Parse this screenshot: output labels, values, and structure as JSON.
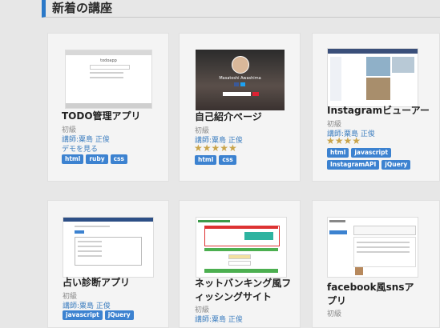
{
  "section": {
    "title": "新着の講座"
  },
  "cards": [
    {
      "title": "TODO管理アプリ",
      "level": "初級",
      "teacher": "講師:粟島 正俊",
      "demo": "デモを見る",
      "tags": [
        "html",
        "ruby",
        "css"
      ],
      "thumb": {
        "app_title": "todoapp"
      }
    },
    {
      "title": "自己紹介ページ",
      "level": "初級",
      "teacher": "講師:粟島 正俊",
      "stars": "★★★★★",
      "tags": [
        "html",
        "css"
      ],
      "thumb": {
        "name": "Masatoshi Awashima"
      }
    },
    {
      "title": "Instagramビューアー",
      "level": "初級",
      "teacher": "講師:粟島 正俊",
      "stars": "★★★★",
      "tags": [
        "html",
        "javascript",
        "InstagramAPI",
        "jQuery"
      ]
    },
    {
      "title": "占い診断アプリ",
      "level": "初級",
      "teacher": "講師:粟島 正俊",
      "tags": [
        "javascript",
        "jQuery"
      ]
    },
    {
      "title": "ネットバンキング風フィッシングサイト",
      "level": "初級",
      "teacher": "講師:粟島 正俊"
    },
    {
      "title": "facebook風snsアプリ",
      "level": "初級"
    }
  ]
}
